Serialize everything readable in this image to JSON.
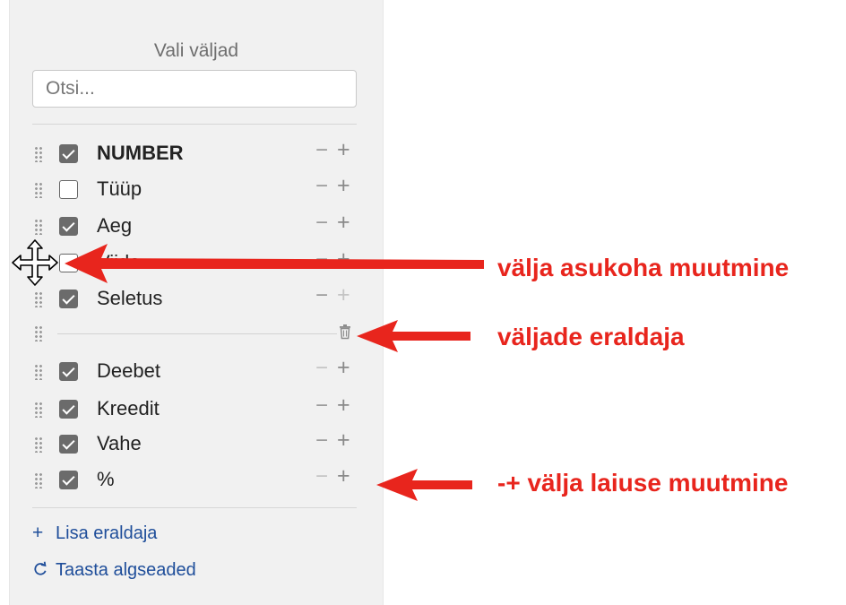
{
  "panel": {
    "title": "Vali väljad",
    "search_placeholder": "Otsi..."
  },
  "fields": [
    {
      "label": "NUMBER",
      "checked": true
    },
    {
      "label": "Tüüp",
      "checked": false
    },
    {
      "label": "Aeg",
      "checked": true
    },
    {
      "label": "Viide",
      "checked": false
    },
    {
      "label": "Seletus",
      "checked": true
    },
    {
      "separator": true
    },
    {
      "label": "Deebet",
      "checked": true
    },
    {
      "label": "Kreedit",
      "checked": true
    },
    {
      "label": "Vahe",
      "checked": true
    },
    {
      "label": "%",
      "checked": true
    }
  ],
  "width_controls": {
    "minus": "−",
    "plus": "+"
  },
  "actions": {
    "add_separator": "Lisa eraldaja",
    "restore_defaults": "Taasta algseaded"
  },
  "annotations": {
    "move_field": "välja asukoha muutmine",
    "separator": "väljade eraldaja",
    "width": "-+ välja laiuse muutmine"
  },
  "colors": {
    "annotation": "#e8251d",
    "link": "#1f4e9a",
    "panel_bg": "#f1f1f1"
  },
  "icons": {
    "drag_handle": "grip-dots-icon",
    "separator_delete": "trash-icon",
    "move_cursor": "move-cursor-icon",
    "add": "plus-icon",
    "restore": "refresh-icon"
  }
}
